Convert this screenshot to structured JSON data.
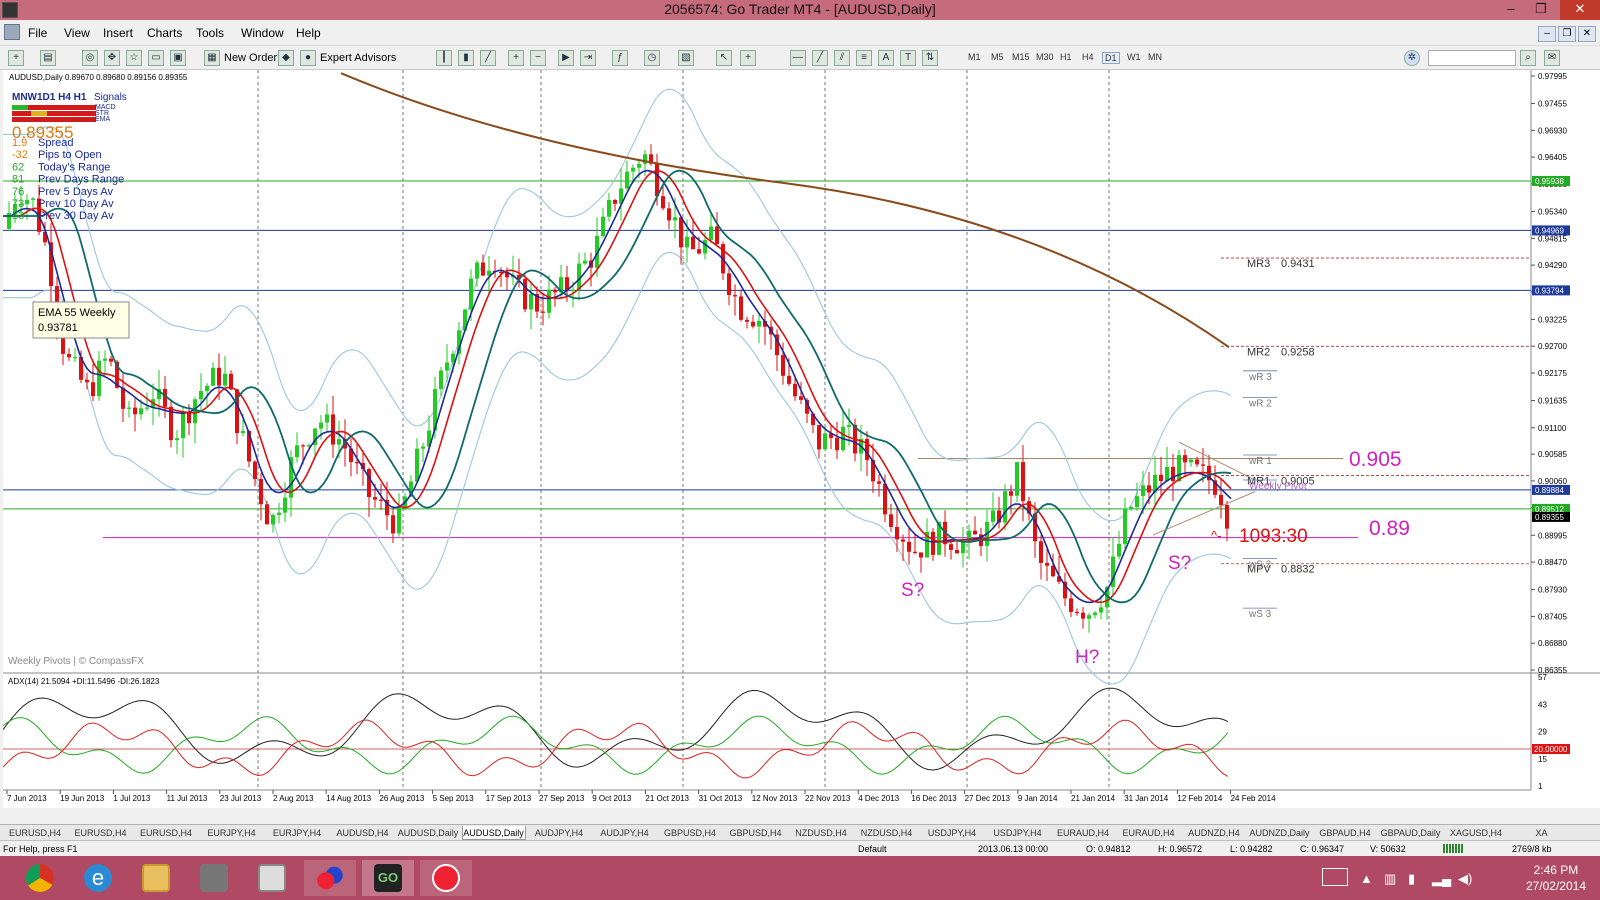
{
  "window": {
    "title": "2056574: Go Trader MT4 - [AUDUSD,Daily]",
    "minimize": "–",
    "maximize": "❐",
    "close": "✕"
  },
  "menu": [
    "File",
    "View",
    "Insert",
    "Charts",
    "Tools",
    "Window",
    "Help"
  ],
  "toolbar": {
    "new_order": "New Order",
    "expert_advisors": "Expert Advisors"
  },
  "timeframes": [
    "M1",
    "M5",
    "M15",
    "M30",
    "H1",
    "H4",
    "D1",
    "W1",
    "MN"
  ],
  "chart": {
    "header": "AUDUSD,Daily  0.89670 0.89680 0.89156 0.89355",
    "signals": {
      "tf_labels": "MNW1D1  H4  H1",
      "title": "Signals",
      "rows": [
        "MACD",
        "STR",
        "EMA"
      ],
      "price": "0.89355",
      "stats": [
        {
          "value": "1.9",
          "label": "Spread"
        },
        {
          "value": "-32",
          "label": "Pips to Open"
        },
        {
          "value": "62",
          "label": "Today's Range"
        },
        {
          "value": "81",
          "label": "Prev Days Range"
        },
        {
          "value": "76",
          "label": "Prev 5 Days Av"
        },
        {
          "value": "73",
          "label": "Prev 10 Day Av"
        },
        {
          "value": "83",
          "label": "Prev 30 Day Av"
        }
      ]
    },
    "ema_tooltip": {
      "name": "EMA 55 Weekly",
      "value": "0.93781"
    },
    "watermark": "Weekly Pivots | © CompassFX",
    "price_scale": [
      "0.97995",
      "0.97455",
      "0.96930",
      "0.96405",
      "0.95880",
      "0.95340",
      "0.94815",
      "0.94290",
      "0.93765",
      "0.93225",
      "0.92700",
      "0.92175",
      "0.91635",
      "0.91100",
      "0.90585",
      "0.90060",
      "0.89535",
      "0.88995",
      "0.88470",
      "0.87930",
      "0.87405",
      "0.86880",
      "0.86355"
    ],
    "price_tags": [
      {
        "value": "0.95938",
        "price": 0.95938,
        "color": "#22aa22"
      },
      {
        "value": "0.94969",
        "price": 0.94969,
        "color": "#1e3a9a"
      },
      {
        "value": "0.93794",
        "price": 0.93794,
        "color": "#1e3a9a"
      },
      {
        "value": "0.89884",
        "price": 0.89884,
        "color": "#1e3a9a"
      },
      {
        "value": "0.89512",
        "price": 0.89512,
        "color": "#22aa22"
      },
      {
        "value": "0.89355",
        "price": 0.89355,
        "color": "#000000"
      }
    ],
    "pivots": [
      {
        "label": "MR3",
        "value": "0.9431",
        "price": 0.9431
      },
      {
        "label": "MR2",
        "value": "0.9258",
        "price": 0.9258
      },
      {
        "label": "MR1",
        "value": "0.9005",
        "price": 0.9005
      },
      {
        "label": "MPV",
        "value": "0.8832",
        "price": 0.8832
      }
    ],
    "weekly_pivots": [
      {
        "label": "wR 3",
        "price": 0.921
      },
      {
        "label": "wR 2",
        "price": 0.9158
      },
      {
        "label": "wR 1",
        "price": 0.9045
      },
      {
        "label": "Weekly Pivot",
        "price": 0.8996
      },
      {
        "label": "wS 2",
        "price": 0.8842
      },
      {
        "label": "wS 3",
        "price": 0.8745
      }
    ],
    "annotations": {
      "level_high": "0.905",
      "level_low": "0.89",
      "countdown": "1093:30",
      "shoulder_left": "S?",
      "shoulder_right": "S?",
      "head": "H?"
    },
    "adx_header": "ADX(14) 21.5094 +DI:11.5496 -DI:26.1823",
    "adx_scale": [
      "57",
      "43",
      "29",
      "20.00000",
      "15",
      "1"
    ],
    "dates": [
      "7 Jun 2013",
      "19 Jun 2013",
      "1 Jul 2013",
      "11 Jul 2013",
      "23 Jul 2013",
      "2 Aug 2013",
      "14 Aug 2013",
      "26 Aug 2013",
      "5 Sep 2013",
      "17 Sep 2013",
      "27 Sep 2013",
      "9 Oct 2013",
      "21 Oct 2013",
      "31 Oct 2013",
      "12 Nov 2013",
      "22 Nov 2013",
      "4 Dec 2013",
      "16 Dec 2013",
      "27 Dec 2013",
      "9 Jan 2014",
      "21 Jan 2014",
      "31 Jan 2014",
      "12 Feb 2014",
      "24 Feb 2014"
    ]
  },
  "tabs": [
    "EURUSD,H4",
    "EURUSD,H4",
    "EURUSD,H4",
    "EURJPY,H4",
    "EURJPY,H4",
    "AUDUSD,H4",
    "AUDUSD,Daily",
    "AUDUSD,Daily",
    "AUDJPY,H4",
    "AUDJPY,H4",
    "GBPUSD,H4",
    "GBPUSD,H4",
    "NZDUSD,H4",
    "NZDUSD,H4",
    "USDJPY,H4",
    "USDJPY,H4",
    "EURAUD,H4",
    "EURAUD,H4",
    "AUDNZD,H4",
    "AUDNZD,Daily",
    "GBPAUD,H4",
    "GBPAUD,Daily",
    "XAGUSD,H4",
    "XA"
  ],
  "active_tab": 7,
  "status": {
    "help": "For Help, press F1",
    "profile": "Default",
    "datetime": "2013.06.13 00:00",
    "open": "O: 0.94812",
    "high": "H: 0.96572",
    "low": "L: 0.94282",
    "close": "C: 0.96347",
    "volume": "V: 50632",
    "traffic": "2769/8 kb"
  },
  "clock": {
    "time": "2:46 PM",
    "date": "27/02/2014"
  },
  "colors": {
    "titlebar": "#c56b7c",
    "taskbar": "#b04a64",
    "magenta": "#d020c0",
    "bull": "#22cc22",
    "bear": "#dd1111"
  }
}
